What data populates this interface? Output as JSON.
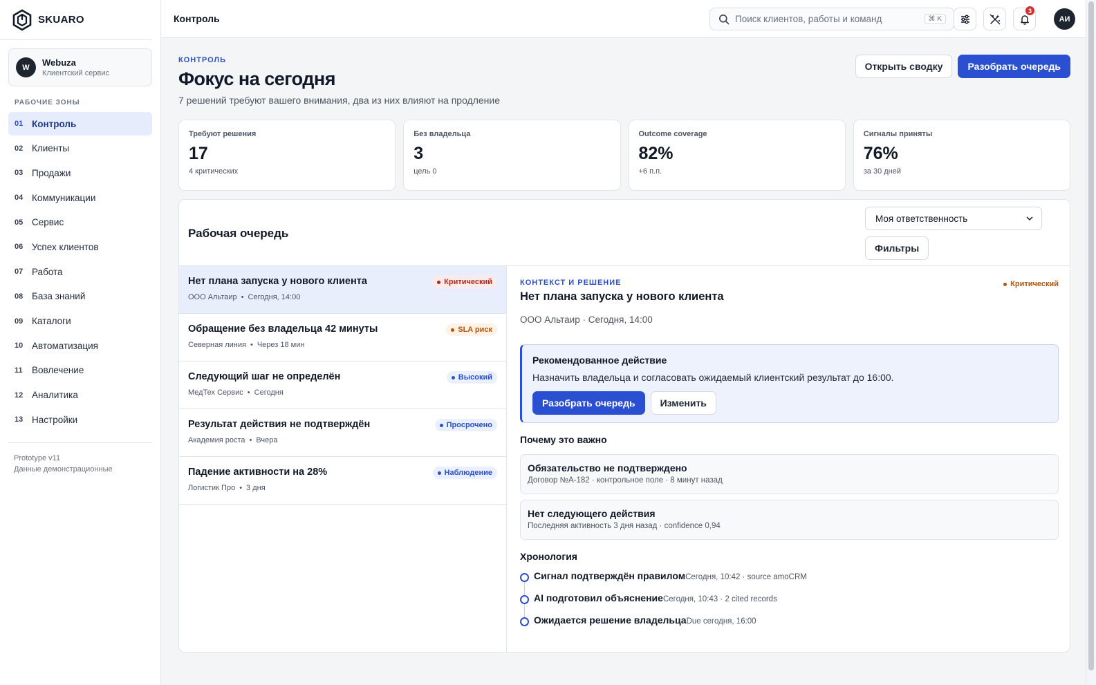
{
  "brand": {
    "name": "SKUARO"
  },
  "org": {
    "initial": "W",
    "name": "Webuza",
    "subtitle": "Клиентский сервис"
  },
  "sidebar": {
    "section_label": "РАБОЧИЕ ЗОНЫ",
    "items": [
      {
        "num": "01",
        "label": "Контроль",
        "active": true
      },
      {
        "num": "02",
        "label": "Клиенты"
      },
      {
        "num": "03",
        "label": "Продажи"
      },
      {
        "num": "04",
        "label": "Коммуникации"
      },
      {
        "num": "05",
        "label": "Сервис"
      },
      {
        "num": "06",
        "label": "Успех клиентов"
      },
      {
        "num": "07",
        "label": "Работа"
      },
      {
        "num": "08",
        "label": "База знаний"
      },
      {
        "num": "09",
        "label": "Каталоги"
      },
      {
        "num": "10",
        "label": "Автоматизация"
      },
      {
        "num": "11",
        "label": "Вовлечение"
      },
      {
        "num": "12",
        "label": "Аналитика"
      },
      {
        "num": "13",
        "label": "Настройки"
      }
    ],
    "footer": {
      "version": "Prototype v11",
      "note": "Данные демонстрационные"
    }
  },
  "topbar": {
    "title": "Контроль",
    "search_placeholder": "Поиск клиентов, работы и команд",
    "search_shortcut": "⌘ K",
    "notifications_count": "3",
    "user_initials": "АИ",
    "icons": [
      "sliders-icon",
      "magic-wand-icon",
      "bell-icon"
    ]
  },
  "page": {
    "eyebrow": "КОНТРОЛЬ",
    "title": "Фокус на сегодня",
    "subtitle": "7 решений требуют вашего внимания, два из них влияют на продление",
    "btn_summary": "Открыть сводку",
    "btn_triage": "Разобрать очередь"
  },
  "stats": [
    {
      "label": "Требуют решения",
      "value": "17",
      "note": "4 критических"
    },
    {
      "label": "Без владельца",
      "value": "3",
      "note": "цель 0"
    },
    {
      "label": "Outcome coverage",
      "value": "82%",
      "note": "+6 п.п."
    },
    {
      "label": "Сигналы приняты",
      "value": "76%",
      "note": "за 30 дней"
    }
  ],
  "queue": {
    "title": "Рабочая очередь",
    "scope_selected": "Моя ответственность",
    "filters_label": "Фильтры",
    "rows": [
      {
        "title": "Нет плана запуска у нового клиента",
        "client": "ООО Альтаир",
        "when": "Сегодня, 14:00",
        "badge": "Критический",
        "badge_kind": "crit"
      },
      {
        "title": "Обращение без владельца 42 минуты",
        "client": "Северная линия",
        "when": "Через 18 мин",
        "badge": "SLA риск",
        "badge_kind": "sla"
      },
      {
        "title": "Следующий шаг не определён",
        "client": "МедТех Сервис",
        "when": "Сегодня",
        "badge": "Высокий",
        "badge_kind": "high"
      },
      {
        "title": "Результат действия не подтверждён",
        "client": "Академия роста",
        "when": "Вчера",
        "badge": "Просрочено",
        "badge_kind": "over"
      },
      {
        "title": "Падение активности на 28%",
        "client": "Логистик Про",
        "when": "3 дня",
        "badge": "Наблюдение",
        "badge_kind": "watch"
      }
    ],
    "meta_sep": "•"
  },
  "detail": {
    "eyebrow": "КОНТЕКСТ И РЕШЕНИЕ",
    "title": "Нет плана запуска у нового клиента",
    "meta": "ООО Альтаир · Сегодня, 14:00",
    "badge": "Критический",
    "recommended": {
      "title": "Рекомендованное действие",
      "text": "Назначить владельца и согласовать ожидаемый клиентский результат до 16:00.",
      "btn_primary": "Разобрать очередь",
      "btn_secondary": "Изменить"
    },
    "why_title": "Почему это важно",
    "reasons": [
      {
        "title": "Обязательство не подтверждено",
        "sub": "Договор №А-182 · контрольное поле · 8 минут назад"
      },
      {
        "title": "Нет следующего действия",
        "sub": "Последняя активность 3 дня назад · confidence 0,94"
      }
    ],
    "timeline_title": "Хронология",
    "timeline": [
      {
        "label": "Сигнал подтверждён правилом",
        "meta": "Сегодня, 10:42 · source amoCRM"
      },
      {
        "label": "AI подготовил объяснение",
        "meta": "Сегодня, 10:43 · 2 cited records"
      },
      {
        "label": "Ожидается решение владельца",
        "meta": "Due сегодня, 16:00"
      }
    ]
  },
  "colors": {
    "accent": "#2a4fd0",
    "critical": "#b3261e",
    "warning": "#b45309"
  }
}
